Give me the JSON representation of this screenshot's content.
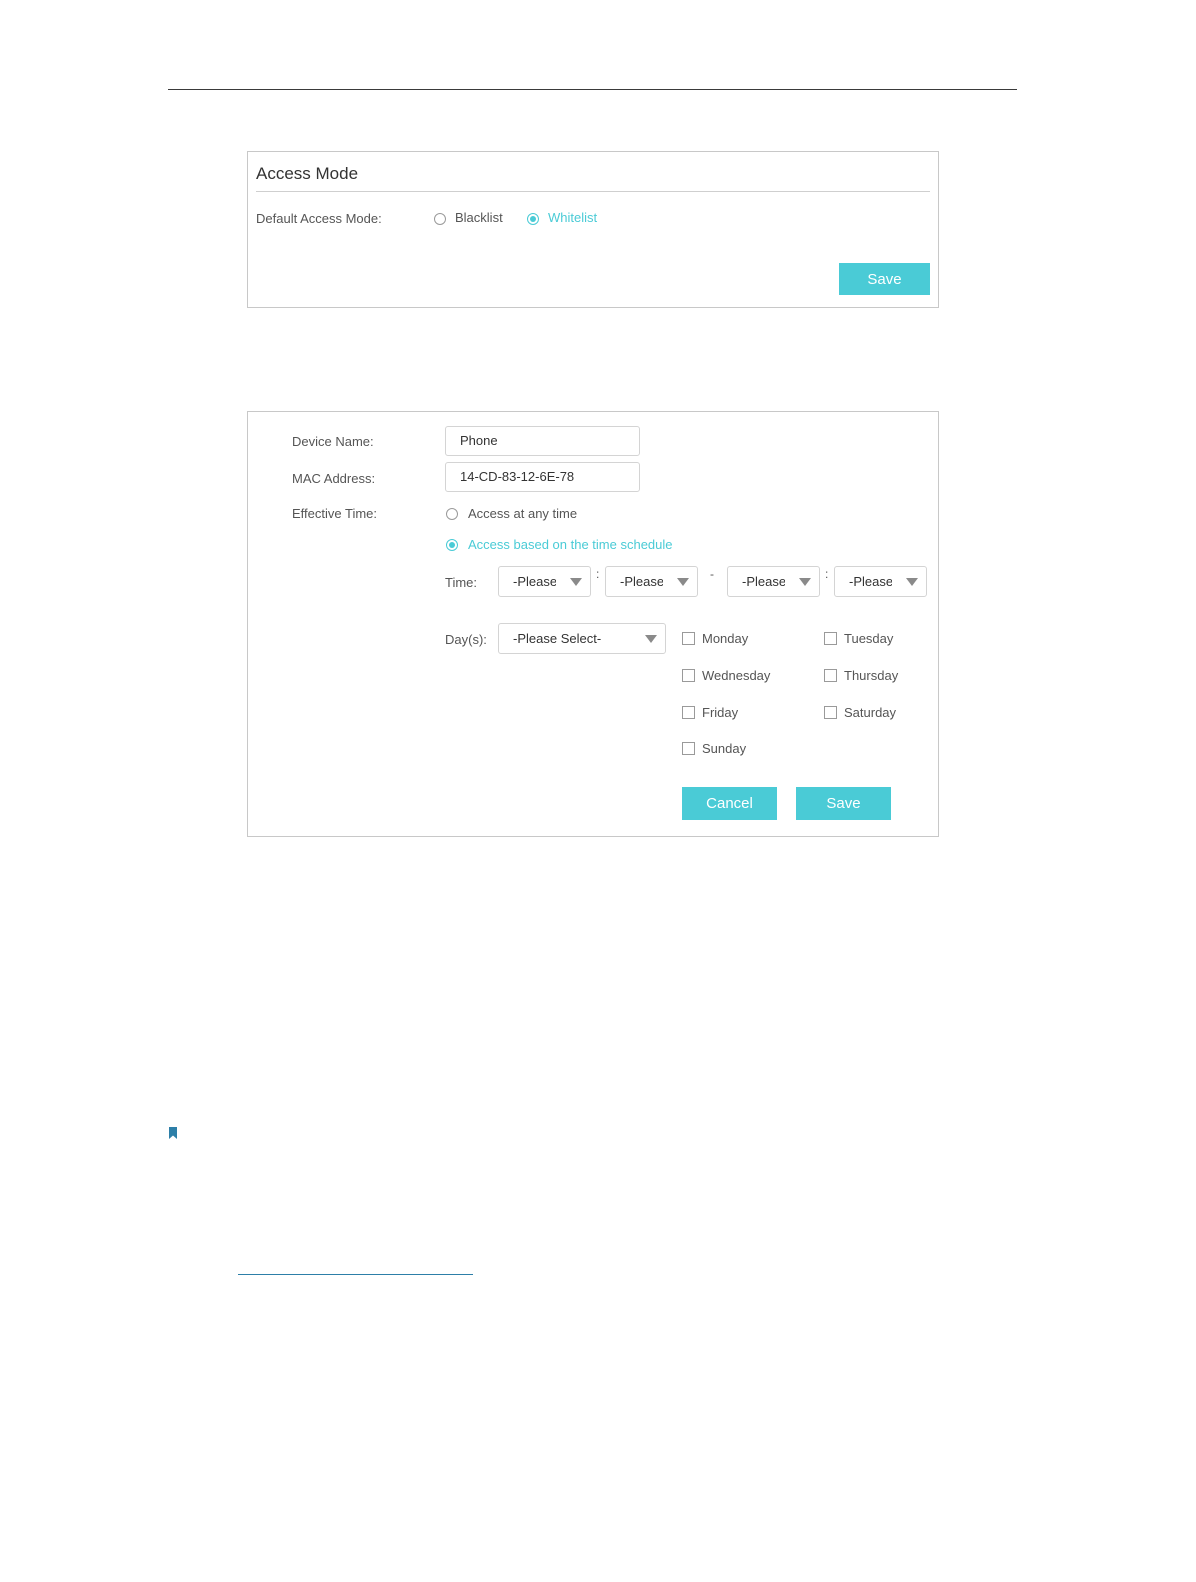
{
  "access_mode": {
    "title": "Access Mode",
    "default_label": "Default Access Mode:",
    "options": [
      "Blacklist",
      "Whitelist"
    ],
    "selected": "Whitelist",
    "save_label": "Save"
  },
  "device_form": {
    "device_name_label": "Device Name:",
    "device_name_value": "Phone",
    "mac_label": "MAC Address:",
    "mac_value": "14-CD-83-12-6E-78",
    "effective_time_label": "Effective Time:",
    "time_options": [
      "Access at any time",
      "Access based on the time schedule"
    ],
    "selected_time_option": "Access based on the time schedule",
    "time_label": "Time:",
    "time_selects": [
      "-Please",
      "-Please",
      "-Please",
      "-Please"
    ],
    "time_separators": [
      ":",
      "-",
      ":"
    ],
    "days_label": "Day(s):",
    "days_select_value": "-Please Select-",
    "days": [
      "Monday",
      "Tuesday",
      "Wednesday",
      "Thursday",
      "Friday",
      "Saturday",
      "Sunday"
    ],
    "cancel_label": "Cancel",
    "save_label": "Save"
  },
  "colors": {
    "accent": "#4acbd6",
    "border": "#c8c8c8",
    "text": "#555555"
  }
}
